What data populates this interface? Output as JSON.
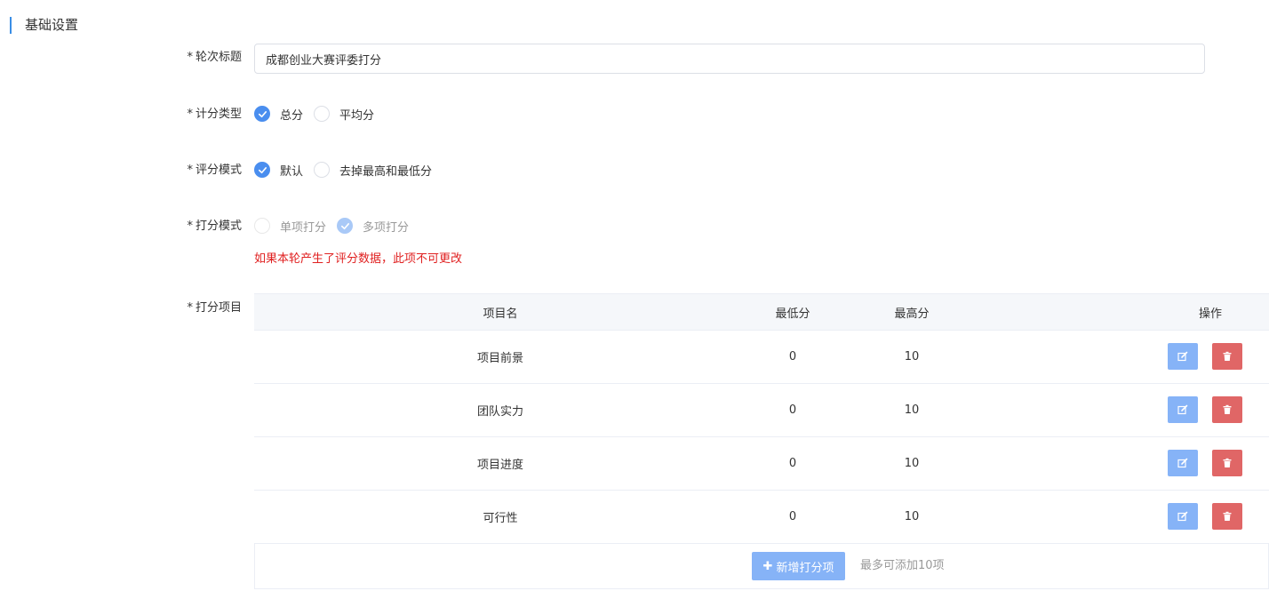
{
  "section": {
    "title": "基础设置"
  },
  "required_mark": "*",
  "fields": {
    "round_title": {
      "label": "轮次标题",
      "value": "成都创业大赛评委打分"
    },
    "score_type": {
      "label": "计分类型",
      "options": [
        "总分",
        "平均分"
      ],
      "selected": "总分"
    },
    "review_mode": {
      "label": "评分模式",
      "options": [
        "默认",
        "去掉最高和最低分"
      ],
      "selected": "默认"
    },
    "scoring_mode": {
      "label": "打分模式",
      "options": [
        "单项打分",
        "多项打分"
      ],
      "selected": "多项打分",
      "disabled": true,
      "warning": "如果本轮产生了评分数据，此项不可更改"
    },
    "scoring_items": {
      "label": "打分项目"
    }
  },
  "table": {
    "headers": {
      "name": "项目名",
      "min": "最低分",
      "max": "最高分",
      "op": "操作"
    },
    "rows": [
      {
        "name": "项目前景",
        "min": "0",
        "max": "10"
      },
      {
        "name": "团队实力",
        "min": "0",
        "max": "10"
      },
      {
        "name": "项目进度",
        "min": "0",
        "max": "10"
      },
      {
        "name": "可行性",
        "min": "0",
        "max": "10"
      }
    ]
  },
  "add": {
    "label": "新增打分项",
    "hint": "最多可添加10项"
  },
  "colors": {
    "primary": "#4a8eef",
    "primary_light": "#86b3f7",
    "danger": "#e06666",
    "warning_text": "#e02020"
  }
}
